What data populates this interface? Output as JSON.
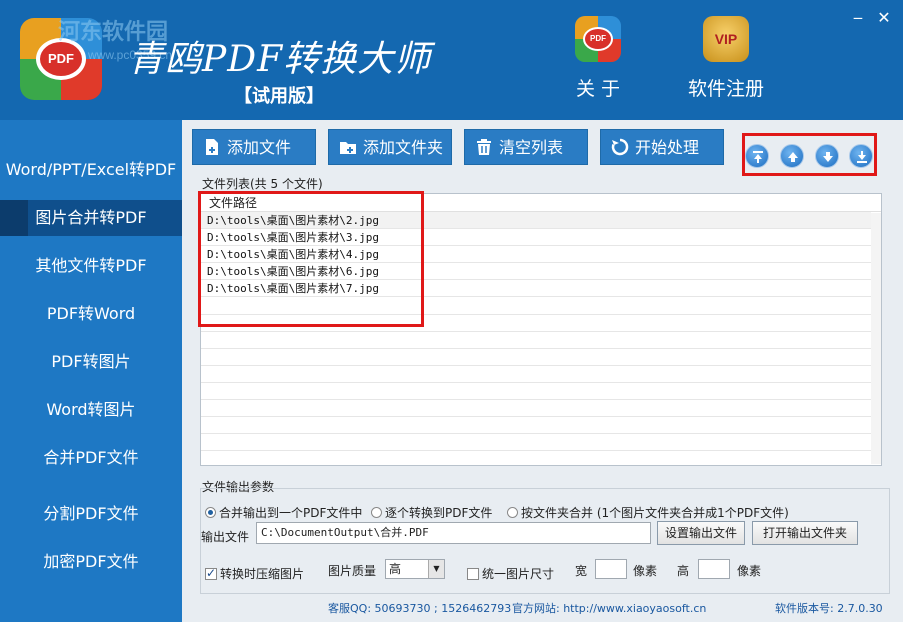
{
  "header": {
    "watermark": "河东软件园",
    "watermark_url": "www.pc0359.cn",
    "title": "青鸥PDF转换大师",
    "subtitle": "【试用版】",
    "logo_text": "PDF",
    "about_label": "关 于",
    "about_icon_text": "PDF",
    "register_label": "软件注册",
    "vip_text": "VIP",
    "minimize": "‒",
    "close": "✕"
  },
  "sidebar": {
    "items": [
      {
        "label": "Word/PPT/Excel转PDF"
      },
      {
        "label": "图片合并转PDF"
      },
      {
        "label": "其他文件转PDF"
      },
      {
        "label": "PDF转Word"
      },
      {
        "label": "PDF转图片"
      },
      {
        "label": "Word转图片"
      },
      {
        "label": "合并PDF文件"
      },
      {
        "label": "分割PDF文件"
      },
      {
        "label": "加密PDF文件"
      }
    ]
  },
  "toolbar": {
    "add_file": "添加文件",
    "add_folder": "添加文件夹",
    "clear_list": "清空列表",
    "start": "开始处理"
  },
  "file_list": {
    "caption": "文件列表(共 5 个文件)",
    "column": "文件路径",
    "rows": [
      "D:\\tools\\桌面\\图片素材\\2.jpg",
      "D:\\tools\\桌面\\图片素材\\3.jpg",
      "D:\\tools\\桌面\\图片素材\\4.jpg",
      "D:\\tools\\桌面\\图片素材\\6.jpg",
      "D:\\tools\\桌面\\图片素材\\7.jpg"
    ]
  },
  "output": {
    "caption": "文件输出参数",
    "radio1": "合并输出到一个PDF文件中",
    "radio2": "逐个转换到PDF文件",
    "radio3": "按文件夹合并 (1个图片文件夹合并成1个PDF文件)",
    "label": "输出文件",
    "path": "C:\\DocumentOutput\\合并.PDF",
    "set_output": "设置输出文件",
    "open_folder": "打开输出文件夹",
    "compress": "转换时压缩图片",
    "quality_label": "图片质量",
    "quality_value": "高",
    "unify": "统一图片尺寸",
    "width_label": "宽",
    "pixel1": "像素",
    "height_label": "高",
    "pixel2": "像素"
  },
  "footer": {
    "support": "客服QQ: 50693730 ; 1526462793",
    "website": "官方网站: http://www.xiaoyaosoft.cn",
    "version": "软件版本号: 2.7.0.30"
  }
}
